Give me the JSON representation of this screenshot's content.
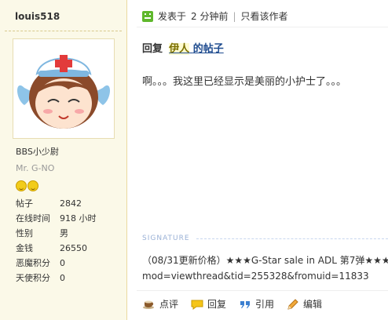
{
  "author": {
    "username": "louis518",
    "rank": "BBS小少尉",
    "title": "Mr. G-NO",
    "stats": [
      {
        "label": "帖子",
        "value": "2842"
      },
      {
        "label": "在线时间",
        "value": "918 小时"
      },
      {
        "label": "性别",
        "value": "男"
      },
      {
        "label": "金钱",
        "value": "26550"
      },
      {
        "label": "恶魔积分",
        "value": "0"
      },
      {
        "label": "天使积分",
        "value": "0"
      }
    ]
  },
  "post": {
    "posted_prefix": "发表于",
    "posted_time": "2 分钟前",
    "only_author": "只看该作者",
    "reply_label": "回复",
    "reply_user": "伊人",
    "reply_suffix": "的帖子",
    "message": "啊。。。我这里已经显示是美丽的小护士了。。。",
    "signature_label": "SIGNATURE",
    "signature_line1": "（08/31更新价格）★★★G-Star sale in ADL 第7弹★★★",
    "signature_line2": "mod=viewthread&tid=255328&fromuid=11833"
  },
  "actions": {
    "rate": "点评",
    "reply": "回复",
    "quote": "引用",
    "edit": "编辑"
  },
  "colors": {
    "sidebar_bg": "#fbf9e8",
    "link_blue": "#1e4b8f",
    "signature_blue": "#9ab1d6",
    "online_green": "#5fb82c"
  }
}
